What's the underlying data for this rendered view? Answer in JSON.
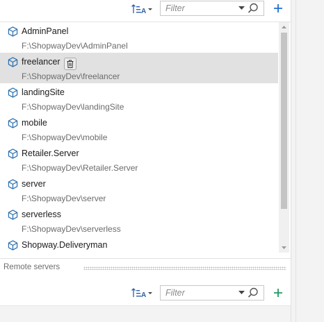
{
  "top_toolbar": {
    "filter_placeholder": "Filter"
  },
  "projects": [
    {
      "name": "AdminPanel",
      "path": "F:\\ShopwayDev\\AdminPanel",
      "selected": false
    },
    {
      "name": "freelancer",
      "path": "F:\\ShopwayDev\\freelancer",
      "selected": true
    },
    {
      "name": "landingSite",
      "path": "F:\\ShopwayDev\\landingSite",
      "selected": false
    },
    {
      "name": "mobile",
      "path": "F:\\ShopwayDev\\mobile",
      "selected": false
    },
    {
      "name": "Retailer.Server",
      "path": "F:\\ShopwayDev\\Retailer.Server",
      "selected": false
    },
    {
      "name": "server",
      "path": "F:\\ShopwayDev\\server",
      "selected": false
    },
    {
      "name": "serverless",
      "path": "F:\\ShopwayDev\\serverless",
      "selected": false
    },
    {
      "name": "Shopway.Deliveryman",
      "path": "",
      "selected": false
    }
  ],
  "remote_servers": {
    "title": "Remote servers",
    "filter_placeholder": "Filter"
  },
  "colors": {
    "accent_top_add": "#1e6fd1",
    "accent_bottom_add": "#1f9a64",
    "cube_icon": "#2a6fb0",
    "selected_row": "#e1e1e1"
  },
  "icons": {
    "sort": "sort-alpha-icon",
    "dropdown": "chevron-down-icon",
    "search": "search-icon",
    "add": "plus-icon",
    "project": "cube-icon",
    "delete": "trash-icon"
  }
}
